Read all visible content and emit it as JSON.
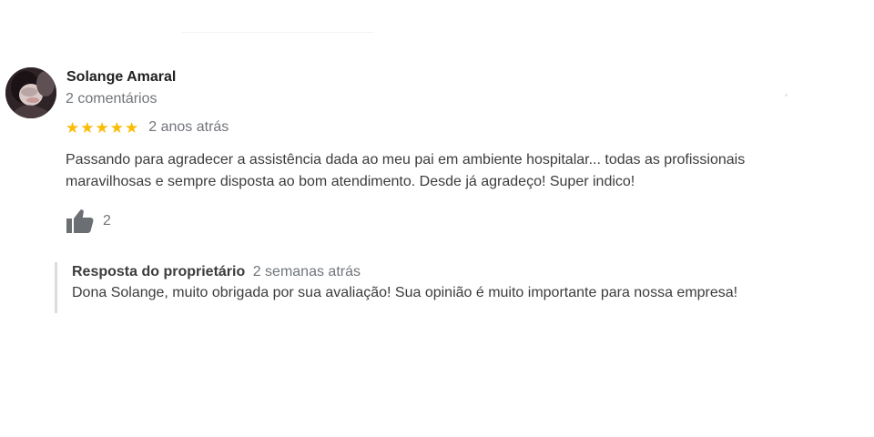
{
  "review": {
    "author_name": "Solange Amaral",
    "author_meta": "2 comentários",
    "rating": 5,
    "stars": [
      "★",
      "★",
      "★",
      "★",
      "★"
    ],
    "time": "2 anos atrás",
    "text": "Passando para agradecer a assistência dada ao meu pai em ambiente hospitalar... todas as profissionais maravilhosas e sempre disposta ao bom atendimento. Desde já agradeço! Super indico!",
    "likes": "2"
  },
  "owner_reply": {
    "title": "Resposta do proprietário",
    "time": "2 semanas atrás",
    "text": "Dona Solange, muito obrigada por sua avaliação! Sua opinião é muito importante para nossa empresa!"
  },
  "icons": {
    "avatar": "user-avatar-photo",
    "like": "thumbs-up-icon",
    "star": "star-icon"
  },
  "colors": {
    "star": "#fbbc04",
    "muted": "#70757a",
    "text": "#3c3c3c",
    "reply_border": "#dadce0"
  }
}
